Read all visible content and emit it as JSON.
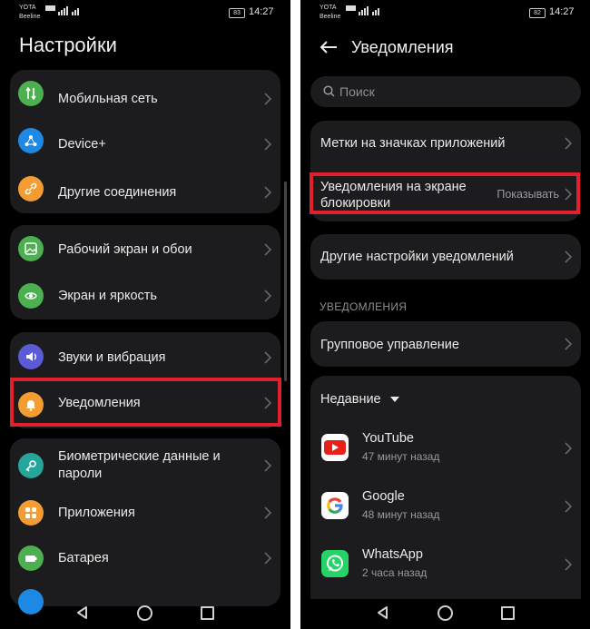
{
  "status_bar": {
    "carrier_top": "YOTA",
    "carrier_bottom": "Beeline",
    "network_badge": "VoLTE",
    "network_gen": "4G",
    "battery_left": "83",
    "battery_right": "82",
    "time": "14:27"
  },
  "left": {
    "title": "Настройки",
    "groups": [
      {
        "items": [
          {
            "label": "Мобильная сеть",
            "icon": "mobile-network-icon",
            "color": "#4caf50"
          },
          {
            "label": "Device+",
            "icon": "device-plus-icon",
            "color": "#1e88e5"
          },
          {
            "label": "Другие соединения",
            "icon": "link-icon",
            "color": "#f39c31"
          }
        ]
      },
      {
        "items": [
          {
            "label": "Рабочий экран и обои",
            "icon": "wallpaper-icon",
            "color": "#4caf50"
          },
          {
            "label": "Экран и яркость",
            "icon": "eye-icon",
            "color": "#4caf50"
          }
        ]
      },
      {
        "items": [
          {
            "label": "Звуки и вибрация",
            "icon": "sound-icon",
            "color": "#5b5bd6"
          },
          {
            "label": "Уведомления",
            "icon": "bell-icon",
            "color": "#f39c31"
          }
        ]
      },
      {
        "items": [
          {
            "label": "Биометрические данные и пароли",
            "label_line1": "Биометрические данные и",
            "label_line2": "пароли",
            "icon": "key-icon",
            "color": "#26a69a"
          },
          {
            "label": "Приложения",
            "icon": "apps-icon",
            "color": "#f39c31"
          },
          {
            "label": "Батарея",
            "icon": "battery-icon",
            "color": "#4caf50"
          }
        ]
      }
    ]
  },
  "right": {
    "title": "Уведомления",
    "search_placeholder": "Поиск",
    "rows": {
      "badges": "Метки на значках приложений",
      "lockscreen_line1": "Уведомления на экране",
      "lockscreen_line2": "блокировки",
      "lockscreen_value": "Показывать",
      "other": "Другие настройки уведомлений"
    },
    "section_label": "УВЕДОМЛЕНИЯ",
    "group_management": "Групповое управление",
    "recent_label": "Недавние",
    "apps": [
      {
        "name": "YouTube",
        "time": "47 минут назад",
        "icon": "youtube-icon"
      },
      {
        "name": "Google",
        "time": "48 минут назад",
        "icon": "google-icon"
      },
      {
        "name": "WhatsApp",
        "time": "2 часа назад",
        "icon": "whatsapp-icon"
      }
    ]
  },
  "colors": {
    "highlight": "#e0202a",
    "card": "#1c1c1e",
    "background": "#000000"
  }
}
